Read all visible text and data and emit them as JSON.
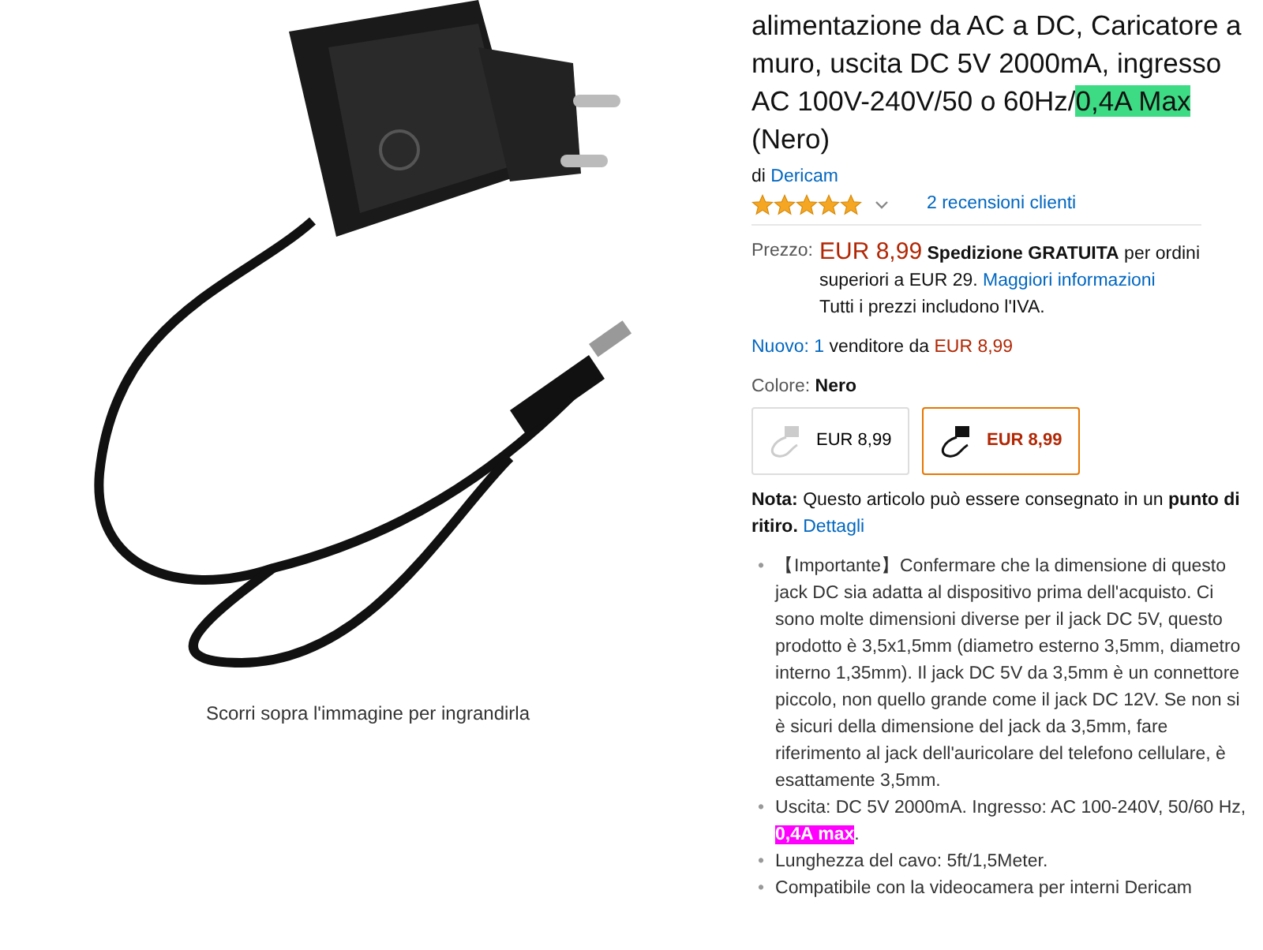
{
  "product_image": {
    "caption": "Scorri sopra l'immagine per ingrandirla"
  },
  "title": [
    {
      "kind": "plain",
      "text": "alimentazione da AC a DC, Caricatore a muro, uscita DC 5V 2000mA, ingresso AC 100V-240V/50 o 60Hz/"
    },
    {
      "kind": "highlight",
      "text": "0,4A Max",
      "color": "#3ddc84"
    },
    {
      "kind": "plain",
      "text": " (Nero)"
    }
  ],
  "brand": {
    "prefix": "di",
    "name": "Dericam"
  },
  "rating": {
    "stars": 5,
    "reviews": "2 recensioni clienti"
  },
  "price": {
    "label": "Prezzo:",
    "amount": "EUR 8,99",
    "shipping": "**Spedizione GRATUITA** per ordini superiori a EUR 29.",
    "link": "Maggiori informazioni",
    "vat": "Tutti i prezzi includono l'IVA."
  },
  "offers": {
    "link": "Nuovo: 1",
    "text": "venditore da",
    "price": "EUR 8,99"
  },
  "color_choice": {
    "label": "Colore:",
    "value": "Nero",
    "options": [
      {
        "kind": "white",
        "price": "EUR 8,99",
        "selected": false
      },
      {
        "kind": "black",
        "price": "EUR 8,99",
        "selected": true
      }
    ]
  },
  "note": {
    "text": "**Nota:** Questo articolo può essere consegnato in un **punto di ritiro.**",
    "link": "Dettagli"
  },
  "bullets": [
    [
      {
        "kind": "bullet",
        "text": "•"
      },
      {
        "kind": "plain",
        "text": "【Importante】Confermare che la dimensione di questo jack DC sia adatta al dispositivo prima dell'acquisto. Ci sono molte dimensioni diverse per il jack DC 5V, questo prodotto è 3,5x1,5mm (diametro esterno 3,5mm, diametro interno 1,35mm). Il jack DC 5V da 3,5mm è un connettore piccolo, non quello grande come il jack DC 12V. Se non si è sicuri della dimensione del jack da 3,5mm, fare riferimento al jack dell'auricolare del telefono cellulare, è esattamente 3,5mm."
      }
    ],
    [
      {
        "kind": "bullet",
        "text": "•"
      },
      {
        "kind": "plain",
        "text": "Uscita: DC 5V 2000mA. Ingresso: AC 100-240V, 50/60 Hz, "
      },
      {
        "kind": "highlight",
        "text": "0,4A max",
        "color": "#ff00ff"
      },
      {
        "kind": "plain",
        "text": "."
      }
    ],
    [
      {
        "kind": "bullet",
        "text": "•"
      },
      {
        "kind": "plain",
        "text": "Lunghezza del cavo: 5ft/1,5Meter."
      }
    ],
    [
      {
        "kind": "bullet",
        "text": "•"
      },
      {
        "kind": "plain",
        "text": "Compatibile con la videocamera per interni Dericam"
      }
    ]
  ]
}
